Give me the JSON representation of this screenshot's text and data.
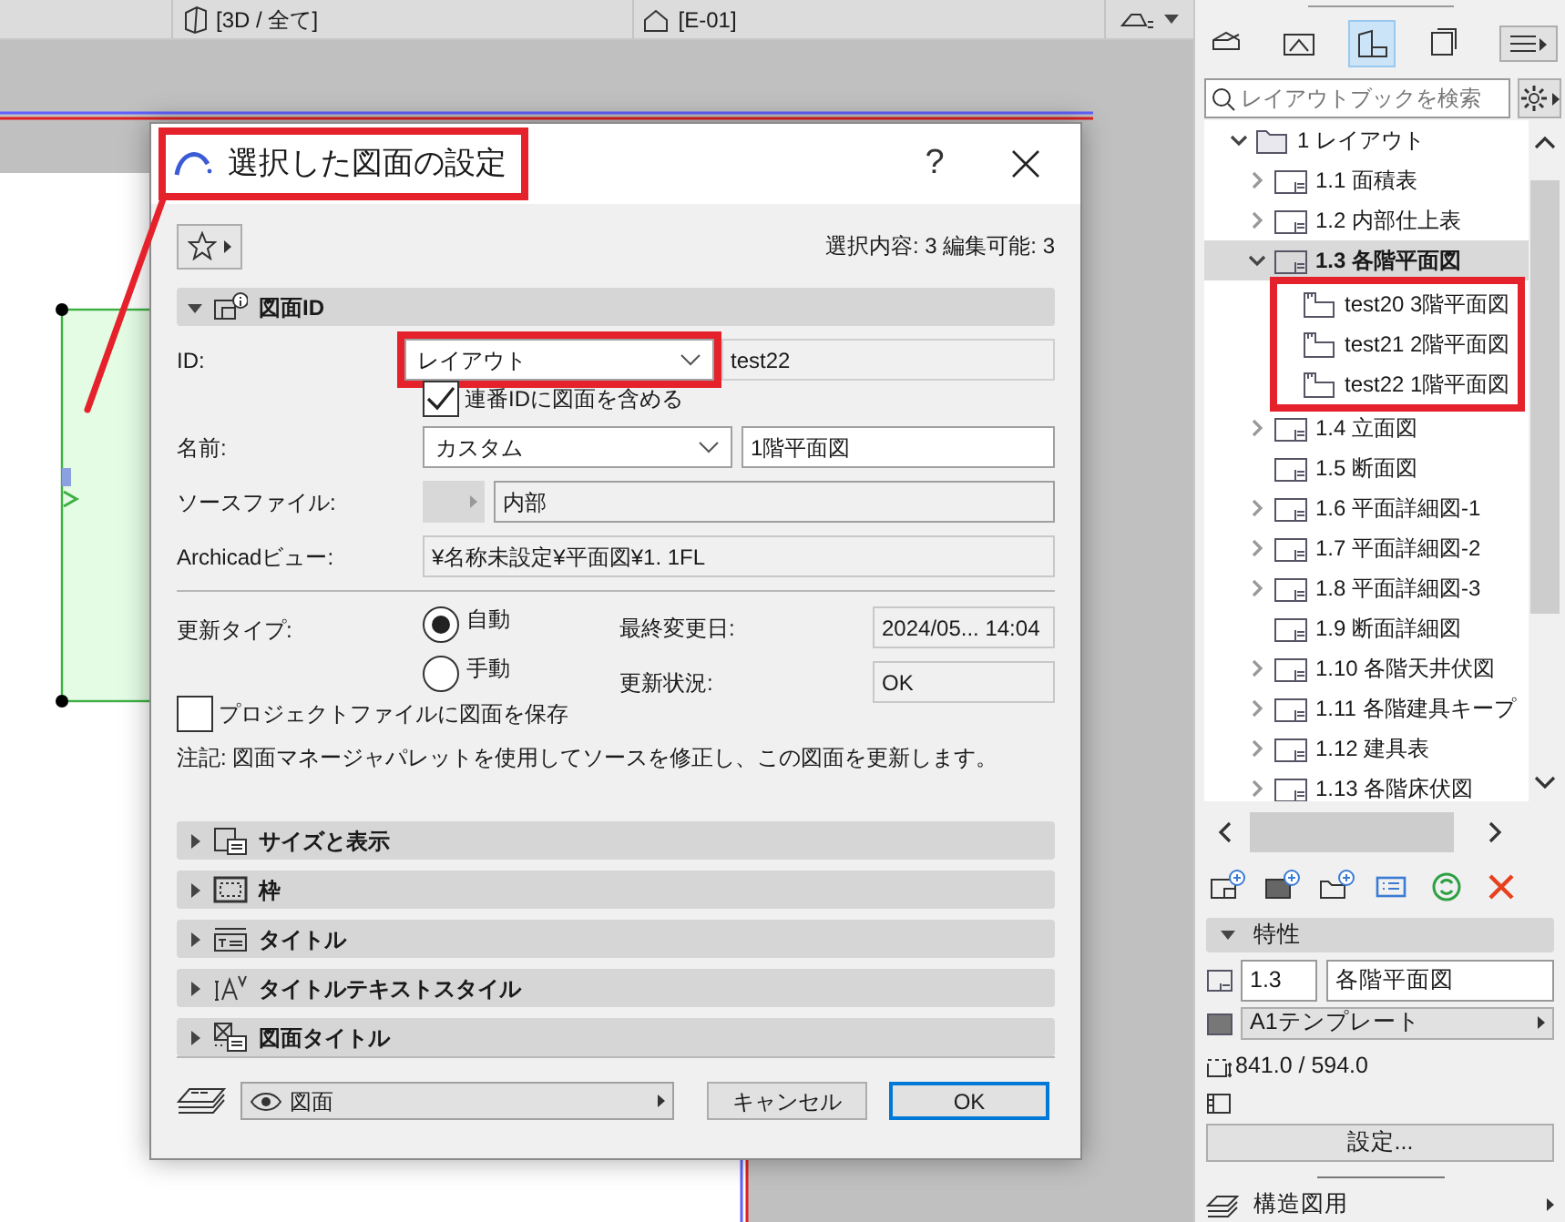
{
  "top_bar": {
    "views": [
      {
        "label": "[3D / 全て]",
        "kind": "perspective"
      },
      {
        "label": "[E-01]",
        "kind": "elevation"
      }
    ]
  },
  "dialog": {
    "title": "選択した図面の設定",
    "title_highlighted": true,
    "help": "?",
    "selection_info": "選択内容: 3 編集可能: 3",
    "sections": [
      {
        "label": "図面ID",
        "kind": "id",
        "expanded": true,
        "id_row": {
          "label": "ID:",
          "source": "レイアウト",
          "source_highlighted": true,
          "value": "test22"
        },
        "include_checkbox": {
          "label": "連番IDに図面を含める",
          "checked": true
        },
        "name_row": {
          "label": "名前:",
          "source": "カスタム",
          "value": "1階平面図"
        },
        "source_file": {
          "label": "ソースファイル:",
          "value": "内部"
        },
        "view_row": {
          "label": "Archicadビュー:",
          "value": "¥名称未設定¥平面図¥1. 1FL"
        },
        "update_type": {
          "label": "更新タイプ:",
          "options": [
            {
              "label": "自動",
              "selected": true
            },
            {
              "label": "手動",
              "selected": false
            }
          ]
        },
        "last_modified": {
          "label": "最終変更日:",
          "value": "2024/05... 14:04"
        },
        "update_status": {
          "label": "更新状況:",
          "value": "OK"
        },
        "save_checkbox": {
          "label": "プロジェクトファイルに図面を保存",
          "checked": false
        },
        "note": "注記: 図面マネージャパレットを使用してソースを修正し、この図面を更新します。"
      },
      {
        "label": "サイズと表示",
        "kind": "size",
        "expanded": false
      },
      {
        "label": "枠",
        "kind": "frame",
        "expanded": false
      },
      {
        "label": "タイトル",
        "kind": "title",
        "expanded": false
      },
      {
        "label": "タイトルテキストスタイル",
        "kind": "text-style",
        "expanded": false
      },
      {
        "label": "図面タイトル",
        "kind": "drawing-title",
        "expanded": false
      }
    ],
    "layer_select": "図面",
    "buttons": [
      {
        "label": "キャンセル",
        "default": false
      },
      {
        "label": "OK",
        "default": true
      }
    ]
  },
  "sidebar": {
    "modes": [
      {
        "kind": "model",
        "selected": false
      },
      {
        "kind": "view",
        "selected": false
      },
      {
        "kind": "layout",
        "selected": true
      },
      {
        "kind": "publisher",
        "selected": false
      }
    ],
    "search": {
      "placeholder": "レイアウトブックを検索"
    },
    "tree": [
      {
        "label": "1 レイアウト",
        "kind": "folder",
        "has_children": true,
        "expanded": true,
        "selected": false,
        "children": [
          {
            "label": "1.1 面積表",
            "kind": "layout",
            "has_children": true,
            "expanded": false,
            "selected": false
          },
          {
            "label": "1.2 内部仕上表",
            "kind": "layout",
            "has_children": true,
            "expanded": false,
            "selected": false
          },
          {
            "label": "1.3 各階平面図",
            "kind": "layout",
            "has_children": true,
            "expanded": true,
            "selected": true,
            "children_highlighted": true,
            "children": [
              {
                "label": "test20 3階平面図",
                "kind": "drawing",
                "has_children": false,
                "selected": false
              },
              {
                "label": "test21 2階平面図",
                "kind": "drawing",
                "has_children": false,
                "selected": false
              },
              {
                "label": "test22 1階平面図",
                "kind": "drawing",
                "has_children": false,
                "selected": false
              }
            ]
          },
          {
            "label": "1.4 立面図",
            "kind": "layout",
            "has_children": true,
            "expanded": false,
            "selected": false
          },
          {
            "label": "1.5 断面図",
            "kind": "layout",
            "has_children": false,
            "selected": false
          },
          {
            "label": "1.6 平面詳細図-1",
            "kind": "layout",
            "has_children": true,
            "expanded": false,
            "selected": false
          },
          {
            "label": "1.7 平面詳細図-2",
            "kind": "layout",
            "has_children": true,
            "expanded": false,
            "selected": false
          },
          {
            "label": "1.8 平面詳細図-3",
            "kind": "layout",
            "has_children": true,
            "expanded": false,
            "selected": false
          },
          {
            "label": "1.9 断面詳細図",
            "kind": "layout",
            "has_children": false,
            "selected": false
          },
          {
            "label": "1.10 各階天井伏図",
            "kind": "layout",
            "has_children": true,
            "expanded": false,
            "selected": false
          },
          {
            "label": "1.11 各階建具キープ",
            "kind": "layout",
            "has_children": true,
            "expanded": false,
            "selected": false
          },
          {
            "label": "1.12 建具表",
            "kind": "layout",
            "has_children": true,
            "expanded": false,
            "selected": false
          },
          {
            "label": "1.13 各階床伏図",
            "kind": "layout",
            "has_children": true,
            "expanded": false,
            "selected": false
          }
        ]
      }
    ],
    "properties": {
      "title": "特性",
      "expanded": true,
      "number": "1.3",
      "name": "各階平面図",
      "master": "A1テンプレート",
      "size": "841.0 / 594.0",
      "settings_button": "設定..."
    },
    "layer_combo": "構造図用"
  }
}
